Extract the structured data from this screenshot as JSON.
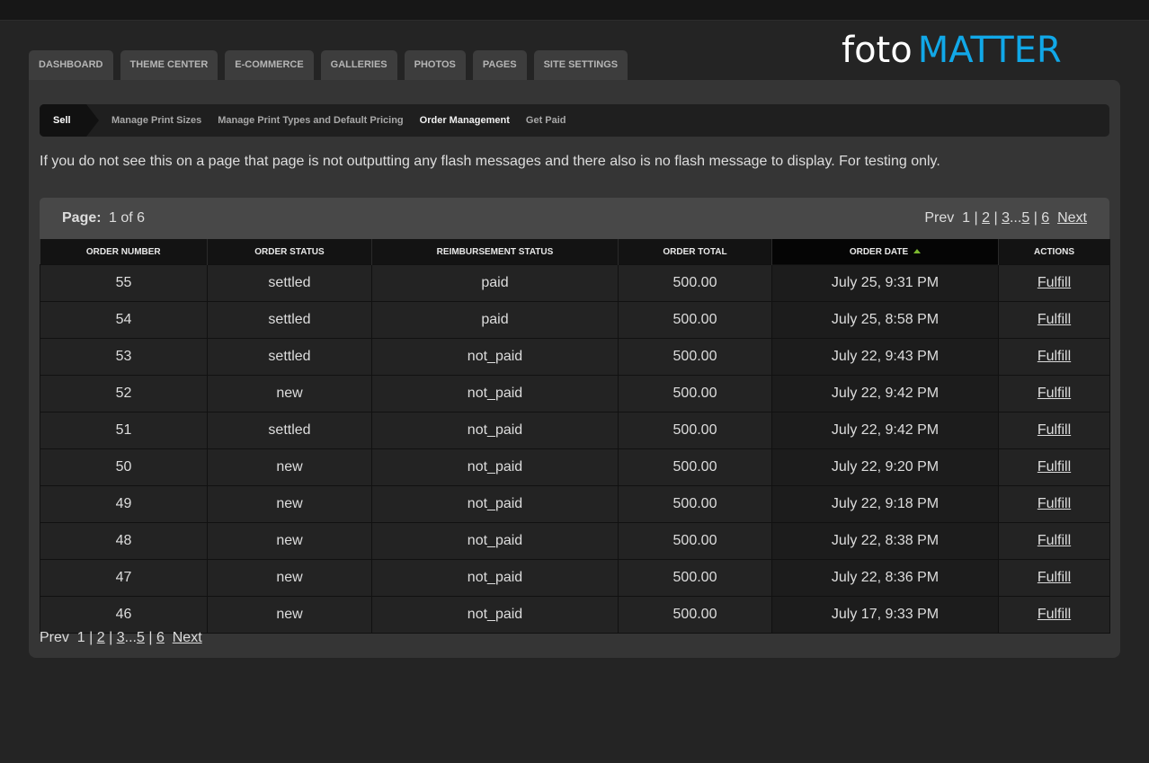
{
  "logo": {
    "part1": "foto",
    "part2": "MATTER"
  },
  "tabs": [
    {
      "label": "DASHBOARD"
    },
    {
      "label": "THEME CENTER"
    },
    {
      "label": "E-COMMERCE"
    },
    {
      "label": "GALLERIES"
    },
    {
      "label": "PHOTOS"
    },
    {
      "label": "PAGES"
    },
    {
      "label": "SITE SETTINGS"
    }
  ],
  "subnav": {
    "current": "Sell",
    "items": [
      {
        "label": "Manage Print Sizes"
      },
      {
        "label": "Manage Print Types and Default Pricing"
      },
      {
        "label": "Order Management"
      },
      {
        "label": "Get Paid"
      }
    ]
  },
  "flash_message": "If you do not see this on a page that page is not outputting any flash messages and there also is no flash message to display. For testing only.",
  "paging": {
    "page_label": "Page:",
    "page_value": "1 of 6",
    "prev": "Prev",
    "current": "1",
    "p2": "2",
    "p3": "3",
    "ellipsis": "...",
    "p5": "5",
    "p6": "6",
    "sep": "|",
    "next": "Next"
  },
  "table": {
    "headers": {
      "order_number": "ORDER NUMBER",
      "order_status": "ORDER STATUS",
      "reimbursement_status": "REIMBURSEMENT STATUS",
      "order_total": "ORDER TOTAL",
      "order_date": "ORDER DATE",
      "actions": "ACTIONS"
    },
    "action_label": "Fulfill",
    "rows": [
      {
        "number": "55",
        "status": "settled",
        "reimbursement": "paid",
        "total": "500.00",
        "date": "July 25, 9:31 PM"
      },
      {
        "number": "54",
        "status": "settled",
        "reimbursement": "paid",
        "total": "500.00",
        "date": "July 25, 8:58 PM"
      },
      {
        "number": "53",
        "status": "settled",
        "reimbursement": "not_paid",
        "total": "500.00",
        "date": "July 22, 9:43 PM"
      },
      {
        "number": "52",
        "status": "new",
        "reimbursement": "not_paid",
        "total": "500.00",
        "date": "July 22, 9:42 PM"
      },
      {
        "number": "51",
        "status": "settled",
        "reimbursement": "not_paid",
        "total": "500.00",
        "date": "July 22, 9:42 PM"
      },
      {
        "number": "50",
        "status": "new",
        "reimbursement": "not_paid",
        "total": "500.00",
        "date": "July 22, 9:20 PM"
      },
      {
        "number": "49",
        "status": "new",
        "reimbursement": "not_paid",
        "total": "500.00",
        "date": "July 22, 9:18 PM"
      },
      {
        "number": "48",
        "status": "new",
        "reimbursement": "not_paid",
        "total": "500.00",
        "date": "July 22, 8:38 PM"
      },
      {
        "number": "47",
        "status": "new",
        "reimbursement": "not_paid",
        "total": "500.00",
        "date": "July 22, 8:36 PM"
      },
      {
        "number": "46",
        "status": "new",
        "reimbursement": "not_paid",
        "total": "500.00",
        "date": "July 17, 9:33 PM"
      }
    ]
  },
  "colors": {
    "brand_blue": "#11a8e8",
    "sort_arrow": "#7cb82f",
    "background": "#242424",
    "panel": "#353535"
  }
}
